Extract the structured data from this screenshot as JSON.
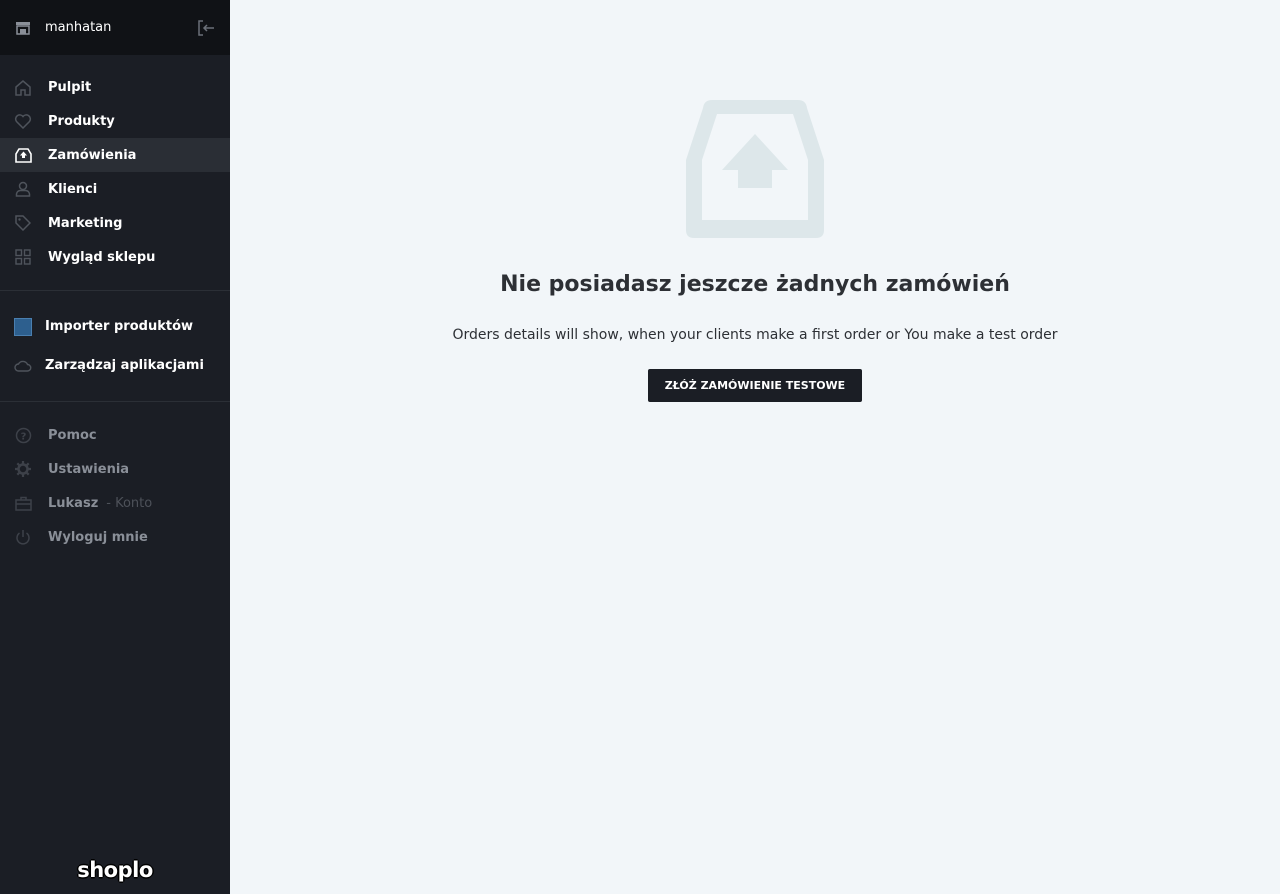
{
  "store": {
    "name": "manhatan",
    "icon": "store-icon",
    "logout_icon": "logout-icon"
  },
  "nav": [
    {
      "label": "Pulpit",
      "icon": "home-icon"
    },
    {
      "label": "Produkty",
      "icon": "heart-icon"
    },
    {
      "label": "Zamówienia",
      "icon": "inbox-icon",
      "active": true
    },
    {
      "label": "Klienci",
      "icon": "user-icon"
    },
    {
      "label": "Marketing",
      "icon": "tag-icon"
    },
    {
      "label": "Wygląd sklepu",
      "icon": "grid-icon"
    }
  ],
  "apps": [
    {
      "label": "Importer produktów",
      "icon": "app-thumbnail"
    },
    {
      "label": "Zarządzaj aplikacjami",
      "icon": "cloud-icon"
    }
  ],
  "account": [
    {
      "label": "Pomoc",
      "icon": "help-icon"
    },
    {
      "label": "Ustawienia",
      "icon": "gear-icon"
    },
    {
      "label": "Lukasz",
      "suffix": "- Konto",
      "icon": "briefcase-icon"
    },
    {
      "label": "Wyloguj mnie",
      "icon": "power-icon"
    }
  ],
  "brand": "shoplo",
  "empty_state": {
    "title": "Nie posiadasz jeszcze żadnych zamówień",
    "description": "Orders details will show, when your clients make a first order or You make a test order",
    "button_label": "ZŁÓŻ ZAMÓWIENIE TESTOWE"
  },
  "colors": {
    "sidebar_bg": "#1b1e25",
    "header_bg": "#101216",
    "main_bg": "#f2f6f9",
    "illustration": "#dde7ea",
    "button_bg": "#1b1e25"
  }
}
